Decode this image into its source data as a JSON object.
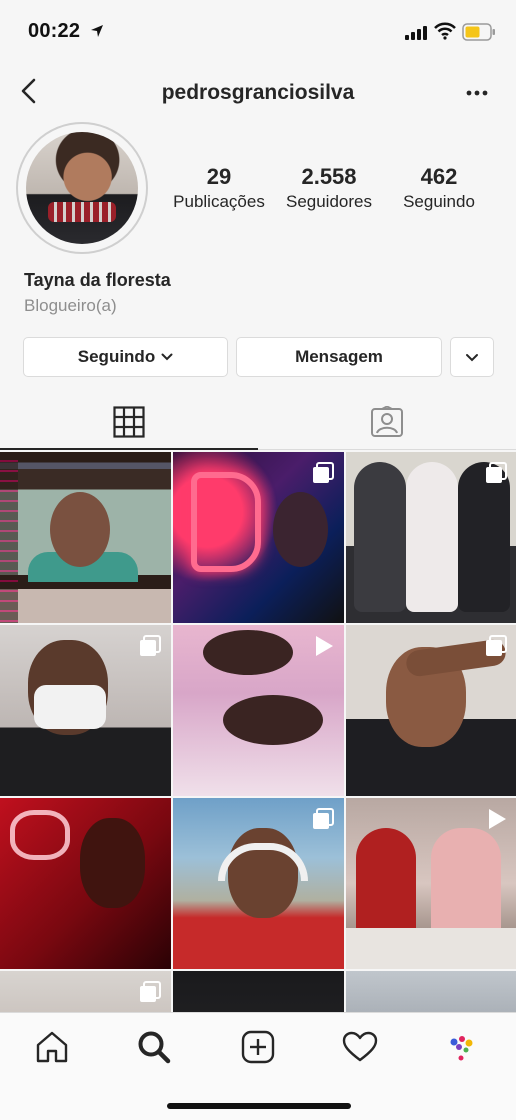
{
  "status_bar": {
    "time": "00:22"
  },
  "header": {
    "username": "pedrosgranciosilva"
  },
  "profile": {
    "stats": [
      {
        "value": "29",
        "label": "Publicações"
      },
      {
        "value": "2.558",
        "label": "Seguidores"
      },
      {
        "value": "462",
        "label": "Seguindo"
      }
    ],
    "display_name": "Tayna da floresta",
    "category": "Blogueiro(a)"
  },
  "actions": {
    "following_label": "Seguindo",
    "message_label": "Mensagem"
  },
  "tabs": [
    {
      "icon": "grid-icon",
      "active": true
    },
    {
      "icon": "tagged-icon",
      "active": false
    }
  ],
  "grid_badges": [
    "carousel",
    "carousel",
    "none",
    "carousel",
    "video",
    "carousel",
    "none",
    "carousel",
    "video",
    "carousel",
    "none",
    "none"
  ],
  "bottom_nav": [
    "home-icon",
    "search-icon",
    "new-post-icon",
    "activity-heart-icon",
    "profile-avatar-icon"
  ],
  "colors": {
    "text": "#262626",
    "secondary_text": "#8e8e8e",
    "border": "#dbdbdb",
    "battery": "#f5c518"
  }
}
